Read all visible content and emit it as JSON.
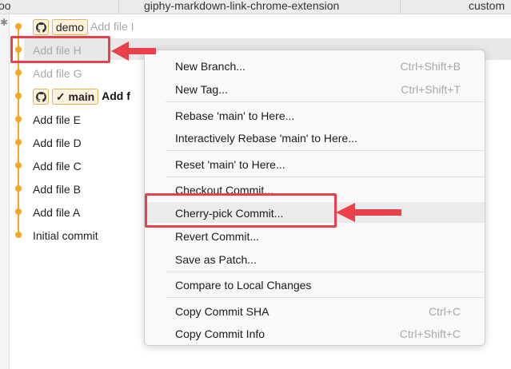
{
  "tabs": [
    "oo",
    "giphy-markdown-link-chrome-extension",
    "custom"
  ],
  "commits": [
    {
      "branch": "demo",
      "message": "Add file I",
      "style": "faded"
    },
    {
      "message": "Add file H",
      "style": "faded"
    },
    {
      "message": "Add file G",
      "style": "faded"
    },
    {
      "branch": "main",
      "branch_check": "✓",
      "message": "Add f",
      "style": "bold"
    },
    {
      "message": "Add file E",
      "style": "normal"
    },
    {
      "message": "Add file D",
      "style": "normal"
    },
    {
      "message": "Add file C",
      "style": "normal"
    },
    {
      "message": "Add file B",
      "style": "normal"
    },
    {
      "message": "Add file A",
      "style": "normal"
    },
    {
      "message": "Initial commit",
      "style": "normal"
    }
  ],
  "menu": {
    "items": [
      {
        "label": "New Branch...",
        "shortcut": "Ctrl+Shift+B"
      },
      {
        "label": "New Tag...",
        "shortcut": "Ctrl+Shift+T"
      },
      {
        "label": "Rebase 'main' to Here..."
      },
      {
        "label": "Interactively Rebase 'main' to Here..."
      },
      {
        "label": "Reset 'main' to Here..."
      },
      {
        "label": "Checkout Commit..."
      },
      {
        "label": "Cherry-pick Commit..."
      },
      {
        "label": "Revert Commit..."
      },
      {
        "label": "Save as Patch..."
      },
      {
        "label": "Compare to Local Changes"
      },
      {
        "label": "Copy Commit SHA",
        "shortcut": "Ctrl+C"
      },
      {
        "label": "Copy Commit Info",
        "shortcut": "Ctrl+Shift+C"
      }
    ]
  },
  "colors": {
    "graph": "#f5a623",
    "highlight": "#e8414b",
    "menu_bg": "#f9f9f9"
  },
  "icons": [
    "gear-icon",
    "github-icon",
    "check-icon",
    "arrow-left-icon"
  ]
}
